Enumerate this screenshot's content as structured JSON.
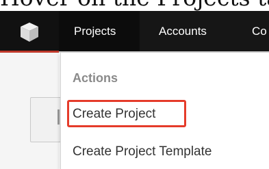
{
  "caption": "Hover on the Projects ta",
  "navbar": {
    "logo_icon": "cube-icon",
    "items": [
      {
        "label": "Projects"
      },
      {
        "label": "Accounts"
      },
      {
        "label": "Co"
      }
    ]
  },
  "dropdown": {
    "heading": "Actions",
    "items": [
      {
        "label": "Create Project",
        "highlighted": true
      },
      {
        "label": "Create Project Template",
        "highlighted": false
      }
    ]
  },
  "colors": {
    "navbar": "#161616",
    "accent_red": "#c0392b",
    "highlight": "#e53b2a"
  }
}
